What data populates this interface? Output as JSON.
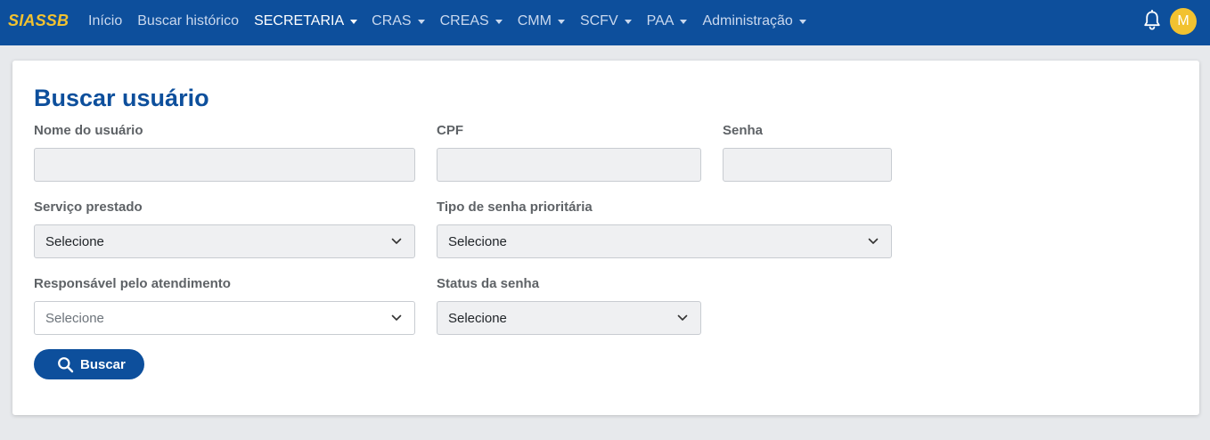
{
  "brand": "SIASSB",
  "nav": {
    "items": [
      {
        "label": "Início",
        "dropdown": false,
        "active": false
      },
      {
        "label": "Buscar histórico",
        "dropdown": false,
        "active": false
      },
      {
        "label": "SECRETARIA",
        "dropdown": true,
        "active": true
      },
      {
        "label": "CRAS",
        "dropdown": true,
        "active": false
      },
      {
        "label": "CREAS",
        "dropdown": true,
        "active": false
      },
      {
        "label": "CMM",
        "dropdown": true,
        "active": false
      },
      {
        "label": "SCFV",
        "dropdown": true,
        "active": false
      },
      {
        "label": "PAA",
        "dropdown": true,
        "active": false
      },
      {
        "label": "Administração",
        "dropdown": true,
        "active": false
      }
    ],
    "avatar_initial": "M",
    "icons": [
      "bell-icon"
    ]
  },
  "page": {
    "title": "Buscar usuário"
  },
  "form": {
    "nome": {
      "label": "Nome do usuário",
      "value": ""
    },
    "cpf": {
      "label": "CPF",
      "value": ""
    },
    "senha": {
      "label": "Senha",
      "value": ""
    },
    "servico": {
      "label": "Serviço prestado",
      "selected": "Selecione"
    },
    "tipo_senha": {
      "label": "Tipo de senha prioritária",
      "selected": "Selecione"
    },
    "responsavel": {
      "label": "Responsável pelo atendimento",
      "selected": "Selecione"
    },
    "status": {
      "label": "Status da senha",
      "selected": "Selecione"
    },
    "buscar_label": "Buscar"
  },
  "colors": {
    "navbar": "#0d4f9c",
    "brand": "#f2c230",
    "accent": "#0d4f9c",
    "avatar": "#f2c230"
  }
}
